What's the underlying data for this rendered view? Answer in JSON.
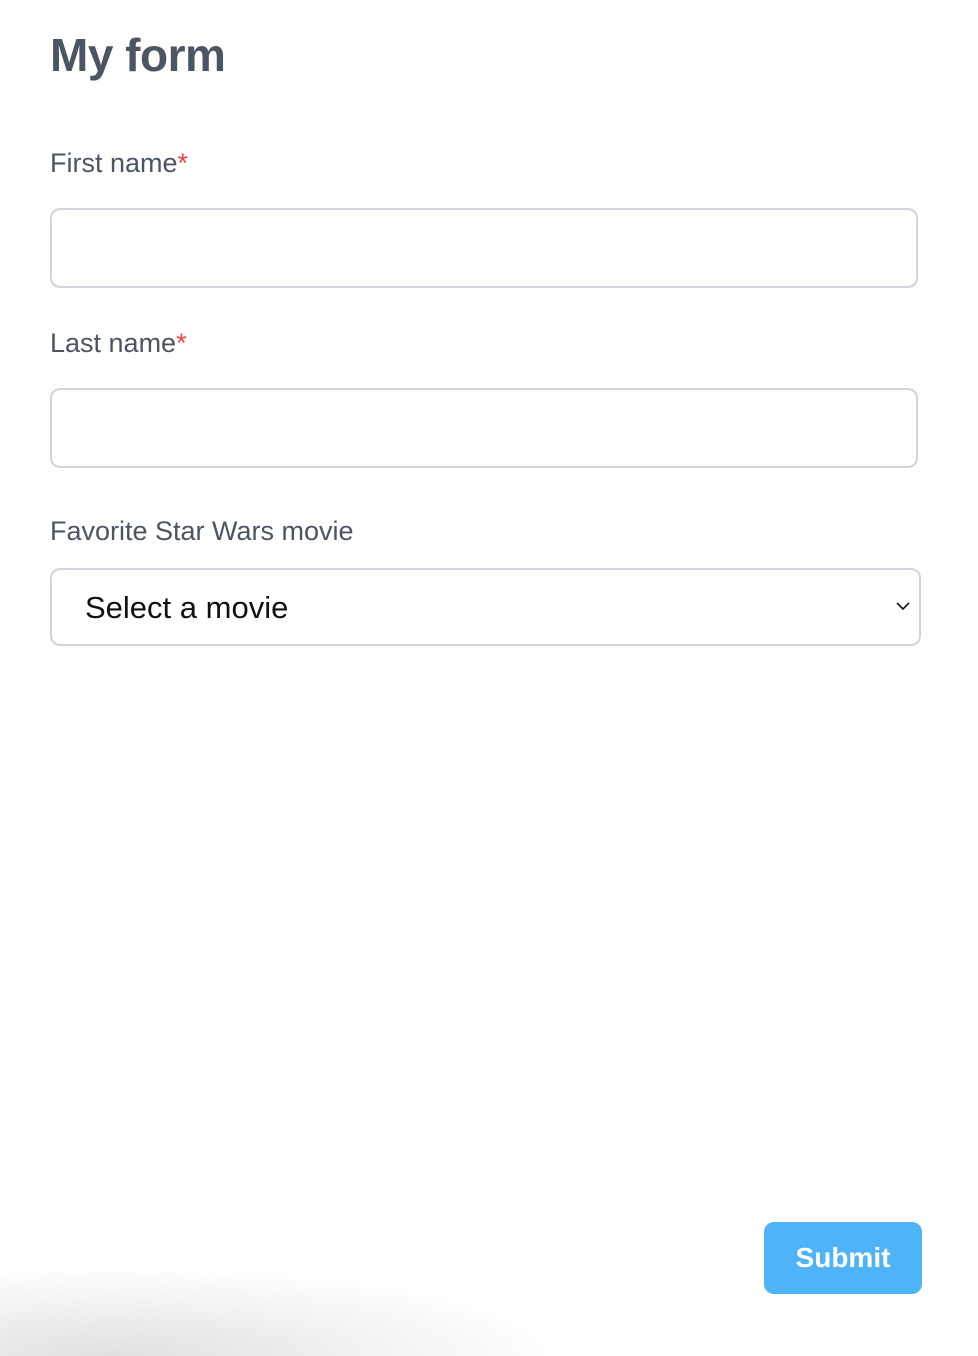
{
  "form": {
    "title": "My form",
    "fields": [
      {
        "label": "First name",
        "required_mark": "*",
        "value": ""
      },
      {
        "label": "Last name",
        "required_mark": "*",
        "value": ""
      }
    ],
    "movie": {
      "label": "Favorite Star Wars movie",
      "selected": "Select a movie"
    },
    "submit_label": "Submit",
    "colors": {
      "accent": "#4fb3f8",
      "required": "#ef4444",
      "text": "#4b5563"
    }
  }
}
